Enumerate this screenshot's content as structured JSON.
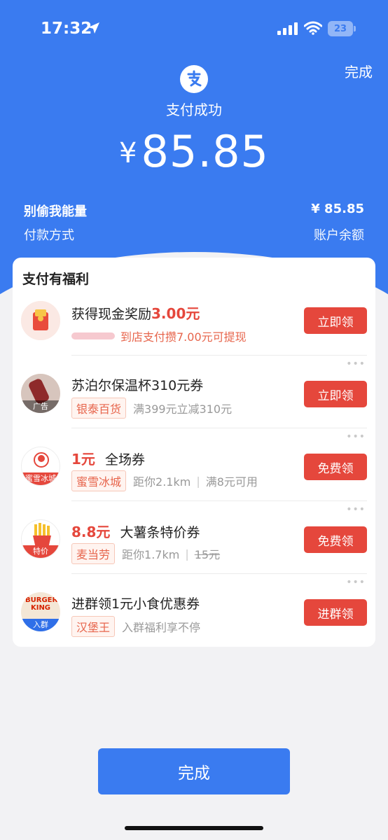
{
  "status": {
    "time": "17:32",
    "battery": "23"
  },
  "header": {
    "done_label": "完成",
    "success_text": "支付成功",
    "currency": "¥",
    "amount": "85.85",
    "payee": "别偷我能量",
    "paid_amount": "¥ 85.85",
    "payment_method_label": "付款方式",
    "payment_method_value": "账户余额"
  },
  "benefits": {
    "title": "支付有福利",
    "items": [
      {
        "title_pre": "获得现金奖励",
        "title_red": "3.00元",
        "progress_text": "到店支付攒7.00元可提现",
        "button": "立即领"
      },
      {
        "title": "苏泊尔保温杯310元券",
        "thumb_tag": "广告",
        "tag": "银泰百货",
        "sub": "满399元立减310元",
        "button": "立即领"
      },
      {
        "title_red": "1元",
        "title_post": "全场券",
        "thumb_text": "蜜雪冰城",
        "tag": "蜜雪冰城",
        "distance": "距你2.1km",
        "cond": "满8元可用",
        "button": "免费领"
      },
      {
        "title_red": "8.8元",
        "title_post": "大薯条特价券",
        "thumb_tag": "特价",
        "tag": "麦当劳",
        "distance": "距你1.7km",
        "orig_price": "15元",
        "button": "免费领"
      },
      {
        "title": "进群领1元小食优惠券",
        "thumb_text1": "BURGER",
        "thumb_text2": "KING",
        "thumb_tag": "入群",
        "tag": "汉堡王",
        "sub": "入群福利享不停",
        "button": "进群领"
      }
    ]
  },
  "footer": {
    "done_label": "完成"
  },
  "colors": {
    "primary_blue": "#3a7bf0",
    "accent_red": "#e5473c",
    "background": "#f2f2f4"
  }
}
